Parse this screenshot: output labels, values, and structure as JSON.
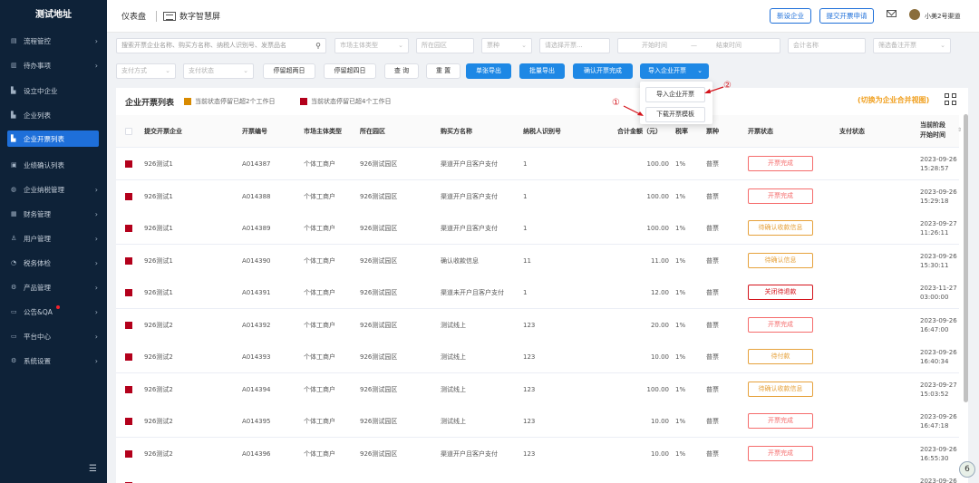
{
  "sidebar": {
    "logo": "测试地址",
    "items": [
      {
        "label": "流程管控",
        "icon": "flow-icon",
        "arrow": true
      },
      {
        "label": "待办事项",
        "icon": "todo-icon",
        "arrow": true
      },
      {
        "label": "设立中企业",
        "icon": "company-icon",
        "arrow": false
      },
      {
        "label": "企业列表",
        "icon": "company-list-icon",
        "arrow": false
      },
      {
        "label": "企业开票列表",
        "icon": "invoice-list-icon",
        "arrow": false,
        "active": true
      },
      {
        "label": "业绩确认列表",
        "icon": "confirm-icon",
        "arrow": false
      },
      {
        "label": "企业纳税管理",
        "icon": "tax-icon",
        "arrow": true
      },
      {
        "label": "财务管理",
        "icon": "finance-icon",
        "arrow": true
      },
      {
        "label": "用户管理",
        "icon": "user-icon",
        "arrow": true
      },
      {
        "label": "税务体检",
        "icon": "check-icon",
        "arrow": true
      },
      {
        "label": "产品管理",
        "icon": "product-icon",
        "arrow": true
      },
      {
        "label": "公告&QA",
        "icon": "notice-icon",
        "arrow": true,
        "dot": true
      },
      {
        "label": "平台中心",
        "icon": "platform-icon",
        "arrow": true
      },
      {
        "label": "系统设置",
        "icon": "settings-icon",
        "arrow": true
      }
    ]
  },
  "topbar": {
    "title": "仪表盘",
    "screen_label": "数字智慧屏",
    "new_company": "新设企业",
    "submit_invoice": "提交开票申请",
    "user": "小美2号渠道"
  },
  "filters": {
    "search_placeholder": "搜索开票企业名称、购买方名称、纳税人识别号、发票品名",
    "market_type": "市场主体类型",
    "park": "所在园区",
    "invoice_type": "票种",
    "invoice_select": "请选择开票...",
    "start_time": "开始时间",
    "range_sep": "—",
    "end_time": "结束时间",
    "accountant": "会计名称",
    "filter_remark": "筛选备注开票",
    "pay_method": "支付方式",
    "pay_status": "支付状态",
    "btn_stay2": "停留超两日",
    "btn_stay4": "停留超四日",
    "btn_query": "查 询",
    "btn_reset": "重 置",
    "btn_single_export": "单张导出",
    "btn_batch_export": "批量导出",
    "btn_confirm_done": "确认开票完成",
    "btn_import": "导入企业开票"
  },
  "dropdown": {
    "import_item": "导入企业开票",
    "download_item": "下载开票模板",
    "annot1": "①",
    "annot2": "②"
  },
  "card": {
    "title": "企业开票列表",
    "legend_orange": "当前状态停留已超2个工作日",
    "legend_red": "当前状态停留已超4个工作日",
    "switch_view": "(切换为企业合并视图)",
    "colors": {
      "orange": "#d88a00",
      "red": "#b3001b"
    }
  },
  "table": {
    "headers": {
      "company": "提交开票企业",
      "number": "开票编号",
      "market": "市场主体类型",
      "park": "所在园区",
      "buyer": "购买方名称",
      "taxid": "纳税人识别号",
      "amount": "合计金额（元）",
      "rate": "税率",
      "kind": "票种",
      "status": "开票状态",
      "pay": "支付状态",
      "time1": "当前阶段",
      "time2": "开始时间"
    },
    "rows": [
      {
        "company": "926测试1",
        "number": "A014387",
        "market": "个体工商户",
        "park": "926测试园区",
        "buyer": "渠道开户且客户支付",
        "taxid": "1",
        "amount": "100.00",
        "rate": "1%",
        "kind": "普票",
        "status": "开票完成",
        "status_color": "red",
        "date": "2023-09-26",
        "time": "15:28:57"
      },
      {
        "company": "926测试1",
        "number": "A014388",
        "market": "个体工商户",
        "park": "926测试园区",
        "buyer": "渠道开户且客户支付",
        "taxid": "1",
        "amount": "100.00",
        "rate": "1%",
        "kind": "普票",
        "status": "开票完成",
        "status_color": "red",
        "date": "2023-09-26",
        "time": "15:29:18"
      },
      {
        "company": "926测试1",
        "number": "A014389",
        "market": "个体工商户",
        "park": "926测试园区",
        "buyer": "渠道开户且客户支付",
        "taxid": "1",
        "amount": "100.00",
        "rate": "1%",
        "kind": "普票",
        "status": "待确认收款信息",
        "status_color": "orange",
        "date": "2023-09-27",
        "time": "11:26:11"
      },
      {
        "company": "926测试1",
        "number": "A014390",
        "market": "个体工商户",
        "park": "926测试园区",
        "buyer": "确认收款信息",
        "taxid": "11",
        "amount": "11.00",
        "rate": "1%",
        "kind": "普票",
        "status": "待确认信息",
        "status_color": "orange",
        "date": "2023-09-26",
        "time": "15:30:11"
      },
      {
        "company": "926测试1",
        "number": "A014391",
        "market": "个体工商户",
        "park": "926测试园区",
        "buyer": "渠道未开户且客户支付",
        "taxid": "1",
        "amount": "12.00",
        "rate": "1%",
        "kind": "普票",
        "status": "关闭待退款",
        "status_color": "darkred",
        "date": "2023-11-27",
        "time": "03:00:00"
      },
      {
        "company": "926测试2",
        "number": "A014392",
        "market": "个体工商户",
        "park": "926测试园区",
        "buyer": "测试线上",
        "taxid": "123",
        "amount": "20.00",
        "rate": "1%",
        "kind": "普票",
        "status": "开票完成",
        "status_color": "red",
        "date": "2023-09-26",
        "time": "16:47:00"
      },
      {
        "company": "926测试2",
        "number": "A014393",
        "market": "个体工商户",
        "park": "926测试园区",
        "buyer": "测试线上",
        "taxid": "123",
        "amount": "10.00",
        "rate": "1%",
        "kind": "普票",
        "status": "待付款",
        "status_color": "orange",
        "date": "2023-09-26",
        "time": "16:40:34"
      },
      {
        "company": "926测试2",
        "number": "A014394",
        "market": "个体工商户",
        "park": "926测试园区",
        "buyer": "测试线上",
        "taxid": "123",
        "amount": "100.00",
        "rate": "1%",
        "kind": "普票",
        "status": "待确认收款信息",
        "status_color": "orange",
        "date": "2023-09-27",
        "time": "15:03:52"
      },
      {
        "company": "926测试2",
        "number": "A014395",
        "market": "个体工商户",
        "park": "926测试园区",
        "buyer": "测试线上",
        "taxid": "123",
        "amount": "10.00",
        "rate": "1%",
        "kind": "普票",
        "status": "开票完成",
        "status_color": "red",
        "date": "2023-09-26",
        "time": "16:47:18"
      },
      {
        "company": "926测试2",
        "number": "A014396",
        "market": "个体工商户",
        "park": "926测试园区",
        "buyer": "渠道开户且客户支付",
        "taxid": "123",
        "amount": "10.00",
        "rate": "1%",
        "kind": "普票",
        "status": "开票完成",
        "status_color": "red",
        "date": "2023-09-26",
        "time": "16:55:30"
      },
      {
        "company": "",
        "number": "",
        "market": "",
        "park": "",
        "buyer": "",
        "taxid": "",
        "amount": "",
        "rate": "",
        "kind": "",
        "status": "",
        "status_color": "red",
        "date": "2023-09-26",
        "time": ""
      }
    ]
  },
  "badge": "6"
}
